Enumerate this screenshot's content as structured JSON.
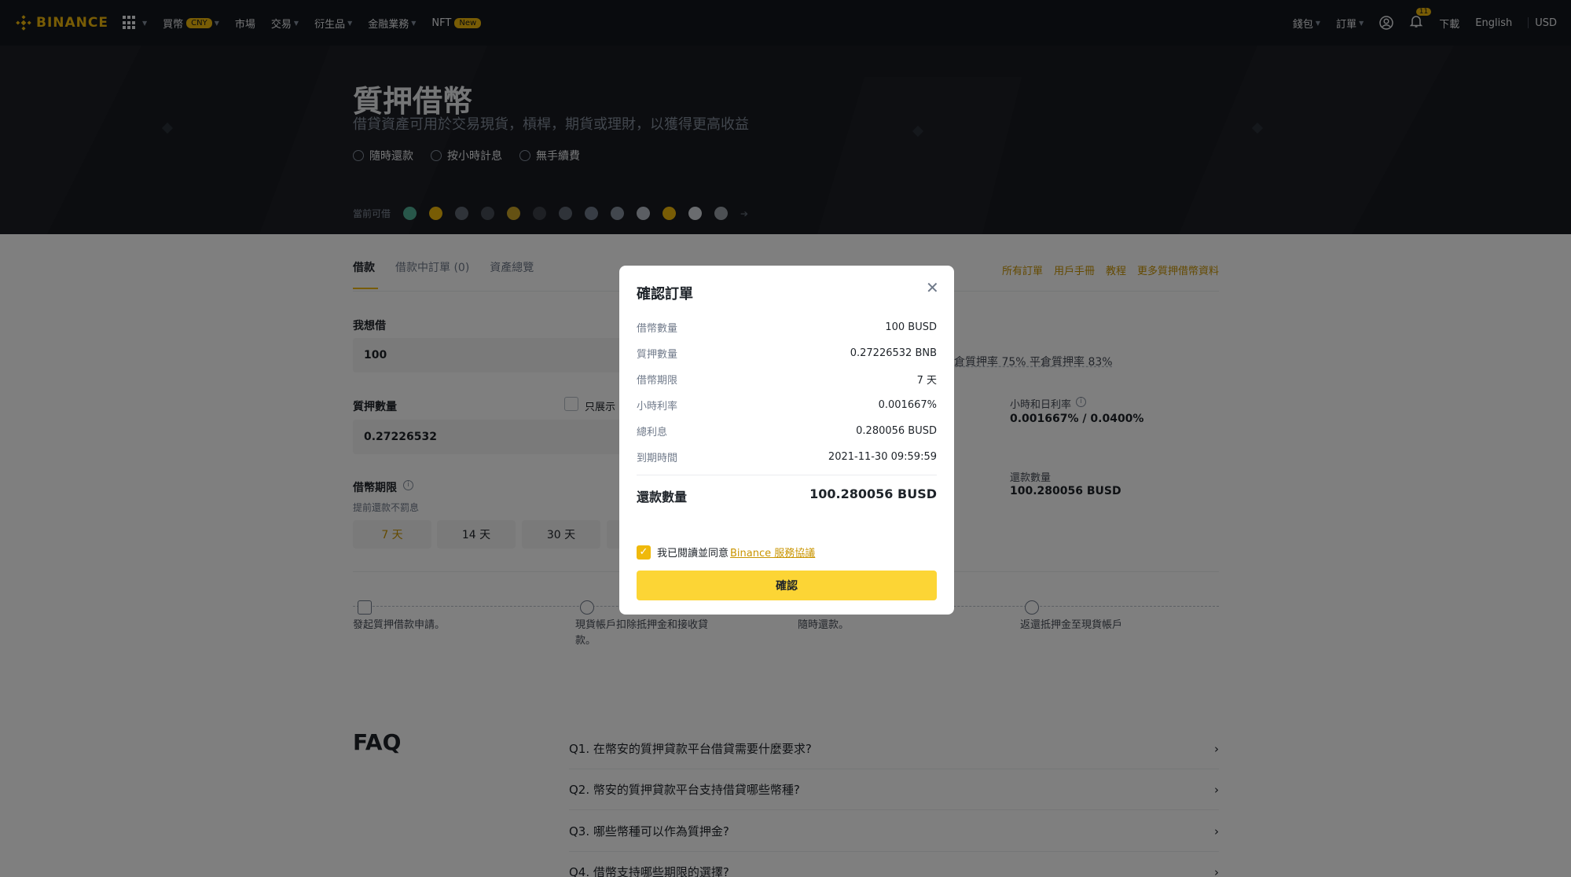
{
  "nav": {
    "brand": "BINANCE",
    "items": [
      {
        "label": "買幣",
        "badge": "CNY",
        "caret": true
      },
      {
        "label": "市場"
      },
      {
        "label": "交易",
        "caret": true
      },
      {
        "label": "衍生品",
        "caret": true
      },
      {
        "label": "金融業務",
        "caret": true
      },
      {
        "label": "NFT",
        "badge": "New"
      }
    ],
    "wallet": "錢包",
    "orders": "訂單",
    "notif_count": "11",
    "download": "下載",
    "language": "English",
    "currency": "USD"
  },
  "hero": {
    "title": "質押借幣",
    "subtitle": "借貸資產可用於交易現貨，槓桿，期貨或理財，以獲得更高收益",
    "features": [
      "隨時還款",
      "按小時計息",
      "無手續費"
    ],
    "available_label": "當前可借"
  },
  "tabs": [
    "借款",
    "借款中訂單 (0)",
    "資產總覽"
  ],
  "links": [
    "所有訂單",
    "用戶手冊",
    "教程",
    "更多質押借幣資料"
  ],
  "form": {
    "borrow_label": "我想借",
    "borrow_value": "100",
    "collateral_label": "質押數量",
    "collateral_value": "0.27226532",
    "only_show": "只展示",
    "term_label": "借幣期限",
    "term_sub": "提前還款不罰息",
    "terms": [
      "7 天",
      "14 天",
      "30 天"
    ],
    "ltv_text": "補倉質押率 75%  平倉質押率 83%",
    "rate_title": "小時和日利率",
    "rate_value": "0.001667% / 0.0400%",
    "repay_title": "還款數量",
    "repay_value": "100.280056 BUSD"
  },
  "steps": [
    "發起質押借款申請。",
    "現貨帳戶扣除抵押金和接收貸款。",
    "隨時還款。",
    "返還抵押金至現貨帳戶"
  ],
  "faq": {
    "title": "FAQ",
    "items": [
      "Q1. 在幣安的質押貸款平台借貸需要什麼要求?",
      "Q2. 幣安的質押貸款平台支持借貸哪些幣種?",
      "Q3. 哪些幣種可以作為質押金?",
      "Q4. 借幣支持哪些期限的選擇?"
    ]
  },
  "modal": {
    "title": "確認訂單",
    "rows": [
      {
        "k": "借幣數量",
        "v": "100 BUSD"
      },
      {
        "k": "質押數量",
        "v": "0.27226532 BNB"
      },
      {
        "k": "借幣期限",
        "v": "7 天"
      },
      {
        "k": "小時利率",
        "v": "0.001667%"
      },
      {
        "k": "總利息",
        "v": "0.280056 BUSD"
      },
      {
        "k": "到期時間",
        "v": "2021-11-30 09:59:59"
      }
    ],
    "total_label": "還款數量",
    "total_value": "100.280056 BUSD",
    "agree_text": "我已閱讀並同意",
    "agree_link": "Binance 服務協議",
    "confirm": "確認"
  },
  "colors": {
    "accent": "#f0b90b",
    "button": "#fcd535",
    "nav_bg": "#12161c"
  }
}
